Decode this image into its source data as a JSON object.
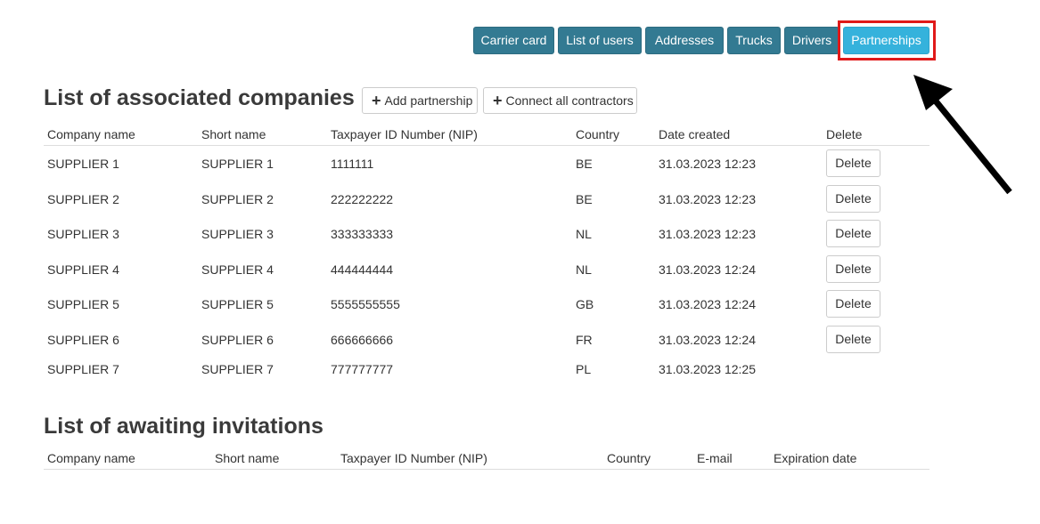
{
  "nav": {
    "buttons": [
      "Carrier card",
      "List of users",
      "Addresses",
      "Trucks",
      "Drivers",
      "Partnerships"
    ],
    "active": "Partnerships"
  },
  "associated": {
    "title": "List of associated companies",
    "add_partnership_label": "Add partnership",
    "connect_all_label": "Connect all contractors",
    "columns": [
      "Company name",
      "Short name",
      "Taxpayer ID Number (NIP)",
      "Country",
      "Date created",
      "Delete"
    ],
    "delete_label": "Delete",
    "rows": [
      {
        "company": "SUPPLIER 1",
        "short": "SUPPLIER 1",
        "nip": "1111111",
        "country": "BE",
        "date": "31.03.2023 12:23"
      },
      {
        "company": "SUPPLIER 2",
        "short": "SUPPLIER 2",
        "nip": "222222222",
        "country": "BE",
        "date": "31.03.2023 12:23"
      },
      {
        "company": "SUPPLIER 3",
        "short": "SUPPLIER 3",
        "nip": "333333333",
        "country": "NL",
        "date": "31.03.2023 12:23"
      },
      {
        "company": "SUPPLIER 4",
        "short": "SUPPLIER 4",
        "nip": "444444444",
        "country": "NL",
        "date": "31.03.2023 12:24"
      },
      {
        "company": "SUPPLIER 5",
        "short": "SUPPLIER 5",
        "nip": "5555555555",
        "country": "GB",
        "date": "31.03.2023 12:24"
      },
      {
        "company": "SUPPLIER 6",
        "short": "SUPPLIER 6",
        "nip": "666666666",
        "country": "FR",
        "date": "31.03.2023 12:24"
      },
      {
        "company": "SUPPLIER 7",
        "short": "SUPPLIER 7",
        "nip": "777777777",
        "country": "PL",
        "date": "31.03.2023 12:25"
      }
    ]
  },
  "invitations": {
    "title": "List of awaiting invitations",
    "columns": [
      "Company name",
      "Short name",
      "Taxpayer ID Number (NIP)",
      "Country",
      "E-mail",
      "Expiration date"
    ]
  },
  "colors": {
    "nav_button": "#337a92",
    "nav_active": "#35b2dc",
    "highlight_box": "#e01919",
    "arrow": "#000000"
  },
  "icons": {
    "add_partnership": "plus-icon",
    "connect_all": "plus-icon",
    "annotation": "arrow-icon"
  }
}
